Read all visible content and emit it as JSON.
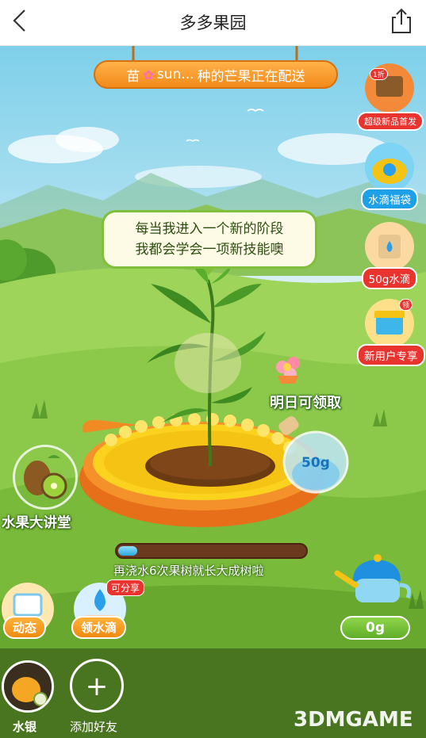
{
  "nav": {
    "title": "多多果园"
  },
  "banner": {
    "prefix": "苗",
    "name": "sun...",
    "text": "种的芒果正在配送"
  },
  "bubble": {
    "line1": "每当我进入一个新的阶段",
    "line2": "我都会学会一项新技能噢"
  },
  "side": {
    "new_product": "超级新品首发",
    "new_product_tag": "1折",
    "water_bag": "水滴福袋",
    "water_50g": "50g水滴",
    "new_user": "新用户专享",
    "new_user_tag": "领"
  },
  "tomorrow": "明日可领取",
  "bottle": "50g",
  "lecture": "水果大讲堂",
  "progress": {
    "value": 0.1,
    "text": "再浇水6次果树就长大成树啦"
  },
  "buttons": {
    "feed": "动态",
    "get_water": "领水滴",
    "share_tag": "可分享"
  },
  "kettle": {
    "amount": "0g"
  },
  "friends": {
    "me": "水银",
    "add": "添加好友"
  },
  "watermark": "3DMGAME",
  "colors": {
    "accent_orange": "#f28a1a",
    "accent_red": "#e8332f",
    "accent_green": "#7fbf3a"
  }
}
